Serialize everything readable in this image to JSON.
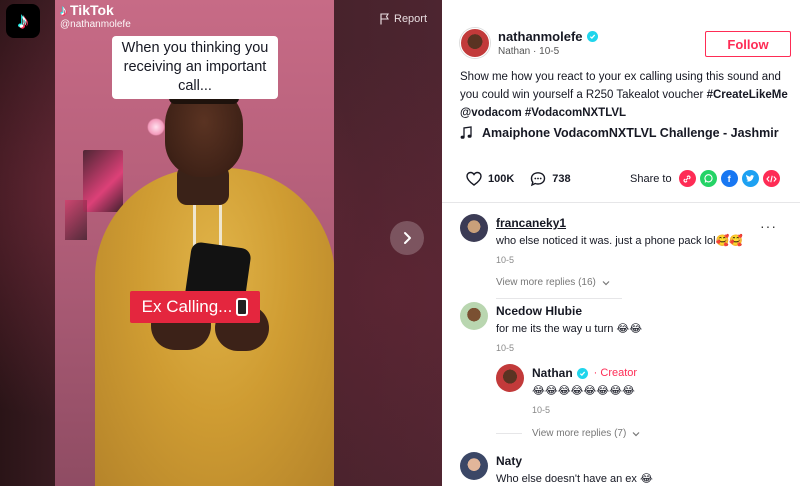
{
  "video": {
    "watermark_brand": "TikTok",
    "watermark_user": "@nathanmolefe",
    "report_label": "Report",
    "caption_text": "When you thinking you receiving an important call...",
    "overlay_text": "Ex Calling..."
  },
  "author": {
    "name": "nathanmolefe",
    "subtitle": "Nathan · 10-5",
    "follow_label": "Follow"
  },
  "description": {
    "text": "Show me how you react to your ex calling using this sound and you could win yourself a R250 Takealot voucher",
    "tag1": "#CreateLikeMe",
    "mention": "@vodacom",
    "tag2": "#VodacomNXTLVL"
  },
  "music": {
    "title": "Amaiphone VodacomNXTLVL Challenge - Jashmir"
  },
  "stats": {
    "likes": "100K",
    "comments": "738",
    "share_label": "Share to"
  },
  "comments": [
    {
      "user": "francaneky1",
      "text": "who else noticed it was. just a phone pack lol🥰🥰",
      "time": "10-5",
      "view_more": "View more replies (16)"
    },
    {
      "user": "Ncedow Hlubie",
      "text": "for me its the way u turn 😂😂",
      "time": "10-5"
    },
    {
      "user": "Nathan",
      "badge": "· Creator",
      "text": "😂😂😂😂😂😂😂😂",
      "time": "10-5",
      "view_more": "View more replies (7)"
    },
    {
      "user": "Naty",
      "text": "Who else doesn't have an ex 😂"
    }
  ],
  "colors": {
    "brand_red": "#fe2c55",
    "overlay_red": "#e4263e",
    "verified": "#20d5ec"
  },
  "icons": [
    "tiktok-logo-icon",
    "flag-icon",
    "chevron-right-icon",
    "verified-icon",
    "music-note-icon",
    "heart-icon",
    "comment-icon",
    "link-icon",
    "whatsapp-icon",
    "facebook-icon",
    "twitter-icon",
    "embed-icon",
    "more-icon",
    "chevron-down-icon"
  ]
}
